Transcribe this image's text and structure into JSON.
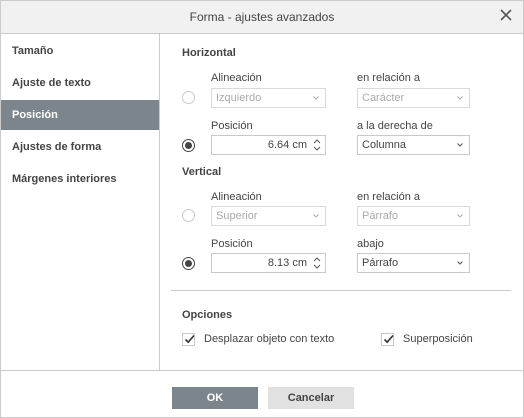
{
  "dialog": {
    "title": "Forma - ajustes avanzados"
  },
  "sidebar": {
    "items": [
      {
        "label": "Tamaño",
        "active": false
      },
      {
        "label": "Ajuste de texto",
        "active": false
      },
      {
        "label": "Posición",
        "active": true
      },
      {
        "label": "Ajustes de forma",
        "active": false
      },
      {
        "label": "Márgenes interiores",
        "active": false
      }
    ]
  },
  "horizontal": {
    "heading": "Horizontal",
    "alignment_label": "Alineación",
    "alignment_value": "Izquierdo",
    "alignment_relative_label": "en relación a",
    "alignment_relative_value": "Carácter",
    "alignment_selected": false,
    "position_label": "Posición",
    "position_value": "6.64 cm",
    "position_relative_label": "a la derecha de",
    "position_relative_value": "Columna",
    "position_selected": true
  },
  "vertical": {
    "heading": "Vertical",
    "alignment_label": "Alineación",
    "alignment_value": "Superior",
    "alignment_relative_label": "en relación a",
    "alignment_relative_value": "Párrafo",
    "alignment_selected": false,
    "position_label": "Posición",
    "position_value": "8.13 cm",
    "position_relative_label": "abajo",
    "position_relative_value": "Párrafo",
    "position_selected": true
  },
  "options": {
    "heading": "Opciones",
    "move_with_text_label": "Desplazar objeto con texto",
    "move_with_text_checked": true,
    "overlap_label": "Superposición",
    "overlap_checked": true
  },
  "footer": {
    "ok_label": "OK",
    "cancel_label": "Cancelar"
  },
  "colors": {
    "accent": "#7d858c",
    "border": "#cbcbcb",
    "titlebar": "#f1f1f1",
    "cancel_bg": "#e1e1e1"
  }
}
